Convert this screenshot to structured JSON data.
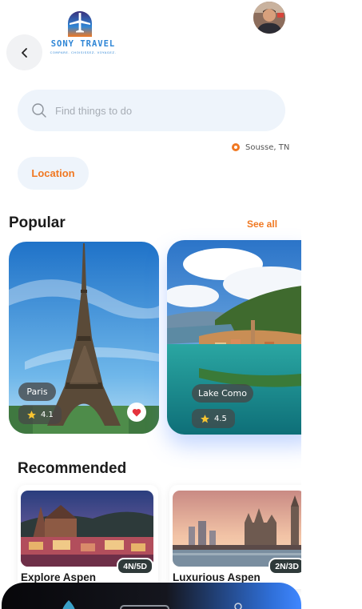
{
  "header": {
    "logo_title": "SONY TRAVEL",
    "logo_tagline": "COMPARE. CHOISISSEZ. VOYAGEZ."
  },
  "search": {
    "placeholder": "Find things to do"
  },
  "location": {
    "current": "Sousse, TN",
    "chip_label": "Location"
  },
  "popular": {
    "title": "Popular",
    "see_all": "See all",
    "cards": [
      {
        "name": "Paris",
        "rating": "4.1"
      },
      {
        "name": "Lake Como",
        "rating": "4.5"
      }
    ]
  },
  "recommended": {
    "title": "Recommended",
    "cards": [
      {
        "title": "Explore Aspen",
        "duration": "4N/5D"
      },
      {
        "title": "Luxurious Aspen",
        "duration": "2N/3D"
      }
    ]
  },
  "colors": {
    "accent": "#f07822",
    "brand": "#2f86d6",
    "search_bg": "#eef4fb"
  }
}
